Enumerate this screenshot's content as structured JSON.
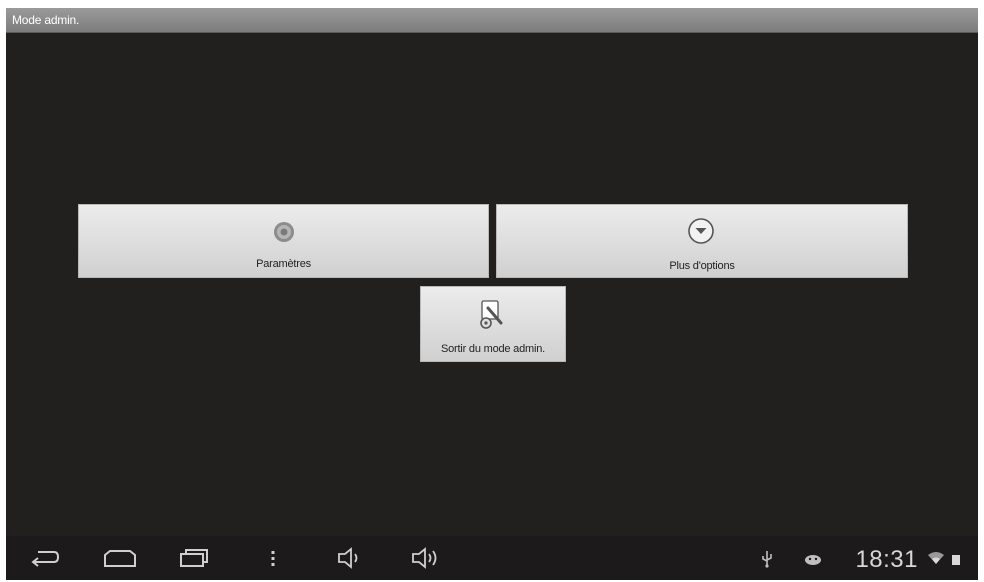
{
  "window": {
    "title": "Mode admin."
  },
  "tiles": {
    "settings": {
      "label": "Paramètres",
      "icon": "gear-icon"
    },
    "more_options": {
      "label": "Plus d'options",
      "icon": "chevron-down-circle-icon"
    },
    "exit_admin": {
      "label": "Sortir du mode admin.",
      "icon": "tools-icon"
    }
  },
  "navbar": {
    "buttons": [
      "back",
      "home",
      "recent-apps",
      "menu",
      "volume-down",
      "volume-up"
    ],
    "status": {
      "time": "18:31",
      "icons": [
        "usb-icon",
        "android-debug-icon",
        "wifi-icon",
        "battery-icon"
      ]
    }
  },
  "colors": {
    "background": "#221f1f",
    "titlebar": "#8a8a8a",
    "tile": "#e0e0e0",
    "icon_tint": "#d0d0d0"
  }
}
